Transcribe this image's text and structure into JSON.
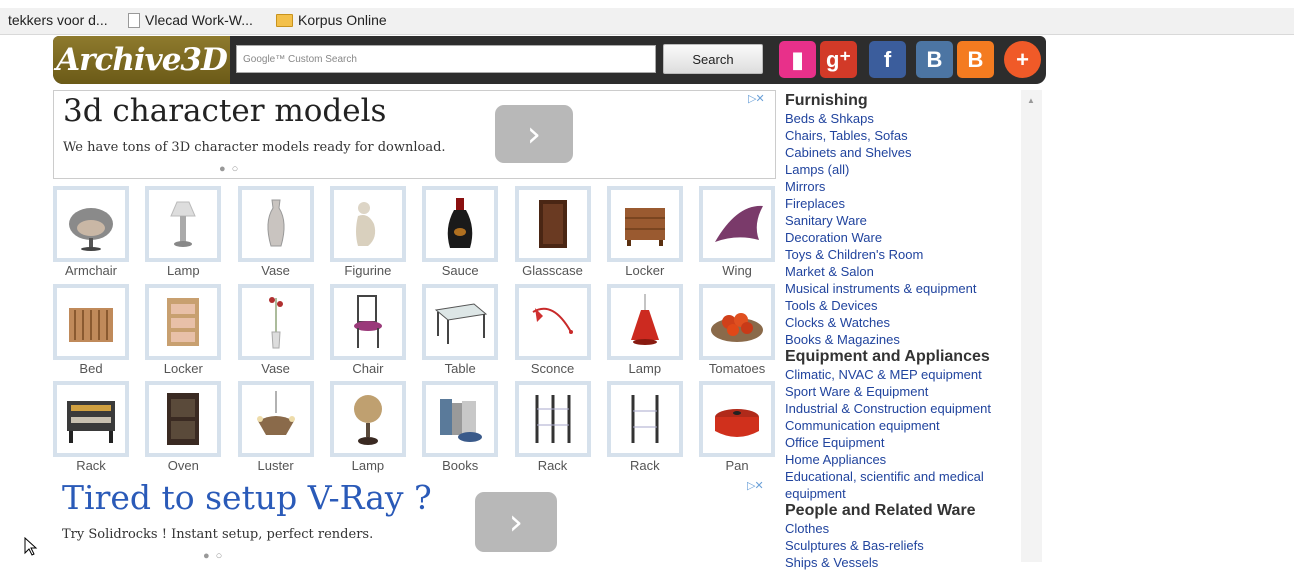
{
  "bookmarks": [
    {
      "label": "tekkers voor d...",
      "icon": "none"
    },
    {
      "label": "Vlecad Work-W...",
      "icon": "page-icon"
    },
    {
      "label": "Korpus Online",
      "icon": "folder-icon"
    }
  ],
  "header": {
    "logo": "Archive3D",
    "search_placeholder": "Google™ Custom Search",
    "search_button": "Search",
    "social": [
      {
        "name": "bookmark-icon",
        "glyph": "▮",
        "color": "#e8308a"
      },
      {
        "name": "google-plus-icon",
        "glyph": "g⁺",
        "color": "#d23a28"
      },
      {
        "name": "facebook-icon",
        "glyph": "f",
        "color": "#3b5d9c"
      },
      {
        "name": "vk-icon",
        "glyph": "B",
        "color": "#4c75a3"
      },
      {
        "name": "blogger-icon",
        "glyph": "B",
        "color": "#f47b20"
      },
      {
        "name": "add-icon",
        "glyph": "+",
        "color": "#f05a28"
      }
    ]
  },
  "ad1": {
    "title": "3d character models",
    "text": "We have tons of 3D character models ready for download.",
    "arrow": "›",
    "dots": "●○"
  },
  "ad2": {
    "title": "Tired to setup V-Ray ?",
    "text": "Try Solidrocks ! Instant setup, perfect renders.",
    "arrow": "›",
    "dots": "●○"
  },
  "adchoices": "▷✕",
  "items": [
    {
      "label": "Armchair",
      "icon": "armchair"
    },
    {
      "label": "Lamp",
      "icon": "lamp"
    },
    {
      "label": "Vase",
      "icon": "vase"
    },
    {
      "label": "Figurine",
      "icon": "figurine"
    },
    {
      "label": "Sauce",
      "icon": "sauce"
    },
    {
      "label": "Glasscase",
      "icon": "glasscase"
    },
    {
      "label": "Locker",
      "icon": "locker"
    },
    {
      "label": "Wing",
      "icon": "wing"
    },
    {
      "label": "Bed",
      "icon": "bed"
    },
    {
      "label": "Locker",
      "icon": "locker2"
    },
    {
      "label": "Vase",
      "icon": "vase2"
    },
    {
      "label": "Chair",
      "icon": "chair"
    },
    {
      "label": "Table",
      "icon": "table"
    },
    {
      "label": "Sconce",
      "icon": "sconce"
    },
    {
      "label": "Lamp",
      "icon": "lamp2"
    },
    {
      "label": "Tomatoes",
      "icon": "tomatoes"
    },
    {
      "label": "Rack",
      "icon": "rack"
    },
    {
      "label": "Oven",
      "icon": "oven"
    },
    {
      "label": "Luster",
      "icon": "luster"
    },
    {
      "label": "Lamp",
      "icon": "lamp3"
    },
    {
      "label": "Books",
      "icon": "books"
    },
    {
      "label": "Rack",
      "icon": "rack2"
    },
    {
      "label": "Rack",
      "icon": "rack3"
    },
    {
      "label": "Pan",
      "icon": "pan"
    }
  ],
  "sidebar": [
    {
      "type": "h",
      "text": "Furnishing"
    },
    {
      "type": "a",
      "text": "Beds & Shkaps"
    },
    {
      "type": "a",
      "text": "Chairs, Tables, Sofas"
    },
    {
      "type": "a",
      "text": "Cabinets and Shelves"
    },
    {
      "type": "a",
      "text": "Lamps (all)"
    },
    {
      "type": "a",
      "text": "Mirrors"
    },
    {
      "type": "a",
      "text": "Fireplaces"
    },
    {
      "type": "a",
      "text": "Sanitary Ware"
    },
    {
      "type": "a",
      "text": "Decoration Ware"
    },
    {
      "type": "a",
      "text": "Toys & Children's Room"
    },
    {
      "type": "a",
      "text": "Market & Salon"
    },
    {
      "type": "a",
      "text": "Musical instruments & equipment"
    },
    {
      "type": "a",
      "text": "Tools & Devices"
    },
    {
      "type": "a",
      "text": "Clocks & Watches"
    },
    {
      "type": "a",
      "text": "Books & Magazines"
    },
    {
      "type": "h",
      "text": "Equipment and Appliances"
    },
    {
      "type": "a",
      "text": "Climatic, NVAC & MEP equipment"
    },
    {
      "type": "a",
      "text": "Sport Ware & Equipment"
    },
    {
      "type": "a",
      "text": "Industrial & Construction equipment"
    },
    {
      "type": "a",
      "text": "Communication equipment"
    },
    {
      "type": "a",
      "text": "Office Equipment"
    },
    {
      "type": "a",
      "text": "Home Appliances"
    },
    {
      "type": "a",
      "text": "Educational, scientific and medical"
    },
    {
      "type": "a",
      "text": "equipment"
    },
    {
      "type": "h",
      "text": "People and Related Ware"
    },
    {
      "type": "a",
      "text": "Clothes"
    },
    {
      "type": "a",
      "text": "Sculptures & Bas-reliefs"
    },
    {
      "type": "a",
      "text": "Ships & Vessels"
    }
  ]
}
